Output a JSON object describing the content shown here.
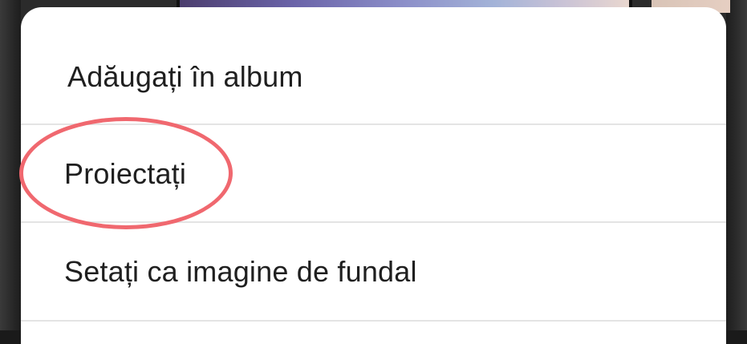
{
  "context_menu": {
    "items": [
      {
        "label": "Adăugați în album"
      },
      {
        "label": "Proiectați"
      },
      {
        "label": "Setați ca imagine de fundal"
      }
    ]
  },
  "annotation": {
    "highlight_color": "#f0686f",
    "highlighted_item": "Proiectați"
  }
}
